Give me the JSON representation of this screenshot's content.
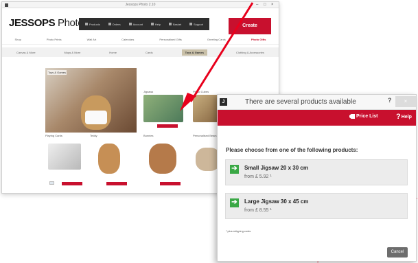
{
  "app": {
    "window_title": "Jessops Photo 2.10",
    "logo_text": "JESSOPS",
    "logo_suffix": " Photo",
    "toolbar": [
      "Products",
      "Orders",
      "Account",
      "Help",
      "Basket",
      "Support"
    ],
    "create_button": "Create",
    "nav_primary": [
      "Shop",
      "Photo Prints",
      "Wall Art",
      "Calendars",
      "Personalised Gifts",
      "Greeting Cards",
      "Photo Gifts"
    ],
    "nav_primary_active_index": 6,
    "nav_secondary": [
      "Canvas & More",
      "Mugs & More",
      "Home",
      "Cards",
      "Toys & Games",
      "Clothing & Accessories"
    ],
    "nav_secondary_active_index": 4,
    "hero_label": "Toys & Games",
    "product_captions": [
      "Jigsaws",
      "Photo Cubes",
      "Playing Cards",
      "Teddy",
      "Bunnies",
      "Personalised Bears"
    ]
  },
  "dialog": {
    "title": "There are several products available",
    "help_glyph": "?",
    "close_glyph": "×",
    "app_icon_letter": "J",
    "price_list_label": "Price List",
    "help_label": "Help",
    "instruction": "Please choose from one of the following products:",
    "options": [
      {
        "name": "Small Jigsaw 20 x 30 cm",
        "from_text": "from  £ 5.92 ¹"
      },
      {
        "name": "Large Jigsaw 30 x 45 cm",
        "from_text": "from  £ 8.55 ¹"
      }
    ],
    "option_arrow_glyph": "➔",
    "footnote": "¹ plus shipping costs",
    "cancel_label": "Cancel"
  },
  "colors": {
    "brand_red": "#c8102e",
    "arrow_red": "#e8001c",
    "option_green": "#3aa845"
  }
}
